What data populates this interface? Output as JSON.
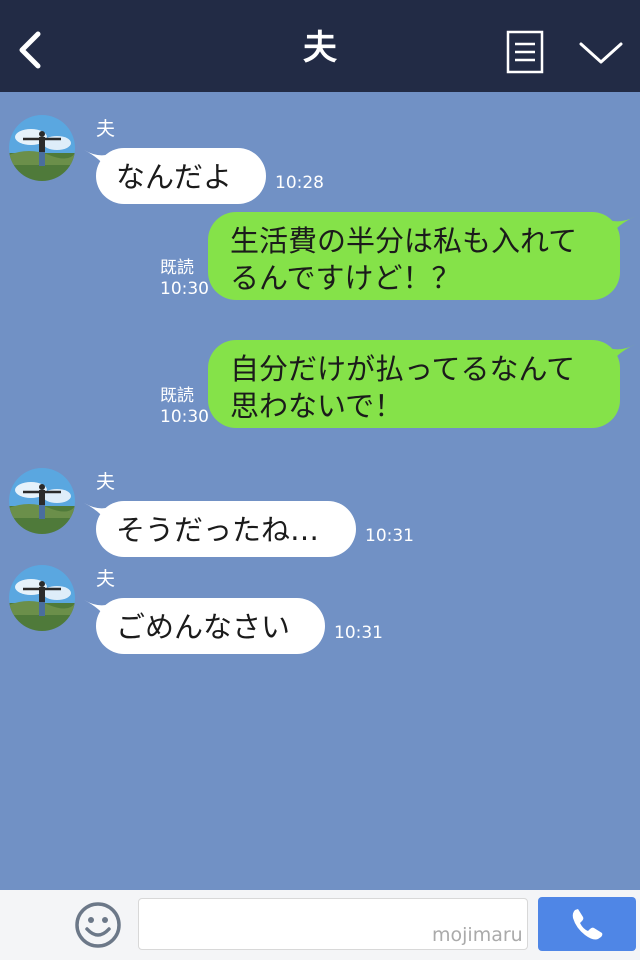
{
  "header": {
    "title": "夫",
    "back_icon": "chevron-left-icon",
    "menu_icon": "note-menu-icon",
    "expand_icon": "chevron-down-icon"
  },
  "messages": [
    {
      "side": "in",
      "sender": "夫",
      "lines": [
        "なんだよ"
      ],
      "time": "10:28"
    },
    {
      "side": "out",
      "read": "既読",
      "lines": [
        "生活費の半分は私も入れて",
        "るんですけど！？"
      ],
      "time": "10:30"
    },
    {
      "side": "out",
      "read": "既読",
      "lines": [
        "自分だけが払ってるなんて",
        "思わないで！"
      ],
      "time": "10:30"
    },
    {
      "side": "in",
      "sender": "夫",
      "lines": [
        "そうだったね…"
      ],
      "time": "10:31"
    },
    {
      "side": "in",
      "sender": "夫",
      "lines": [
        "ごめんなさい"
      ],
      "time": "10:31"
    }
  ],
  "footer": {
    "watermark": "mojimaru",
    "input_value": "",
    "plus_icon": "plus-icon",
    "emoji_icon": "smiley-icon",
    "call_icon": "phone-icon"
  },
  "colors": {
    "header_bg": "#222b45",
    "chat_bg": "#7191c5",
    "incoming_bubble": "#ffffff",
    "outgoing_bubble": "#85e249",
    "call_button": "#4f86e6"
  }
}
